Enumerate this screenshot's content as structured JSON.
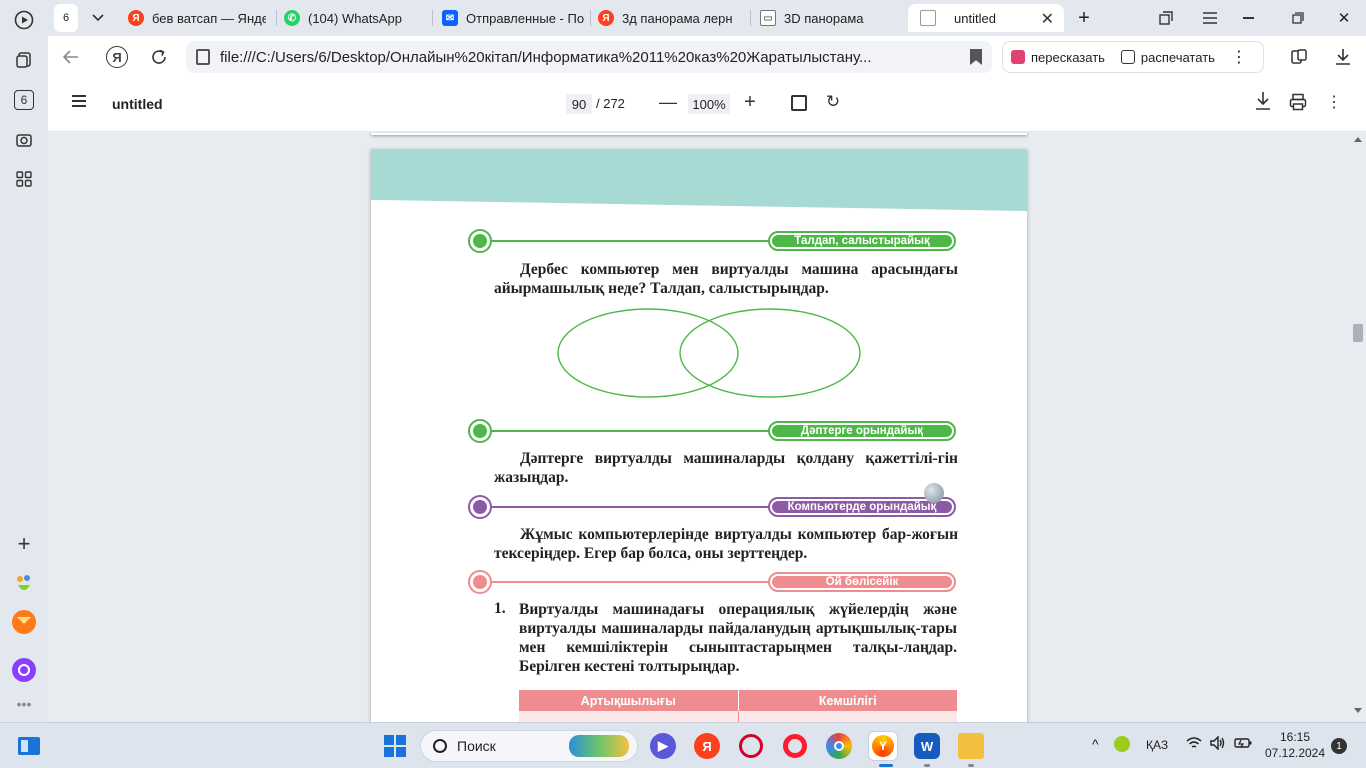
{
  "tabs": [
    {
      "count": "6"
    },
    {
      "title": "бев ватсап — Яндекс",
      "icon": "yandex-icon",
      "color": "#fc3f1d"
    },
    {
      "title": "(104) WhatsApp",
      "icon": "whatsapp-icon",
      "color": "#25d366"
    },
    {
      "title": "Отправленные - Почта",
      "icon": "mail-icon",
      "color": "#0a62ff"
    },
    {
      "title": "3д панорама лерн",
      "icon": "yandex-icon",
      "color": "#fc3f1d"
    },
    {
      "title": "3D панорама",
      "icon": "document-icon",
      "color": "#777777"
    },
    {
      "title": "untitled",
      "icon": "pdf-file-icon",
      "color": "#777777"
    }
  ],
  "address": {
    "url": "file:///C:/Users/6/Desktop/Онлайын%20кітап/Информатика%2011%20каз%20Жаратылыстану..."
  },
  "actions": {
    "retell": "пересказать",
    "print": "распечатать"
  },
  "sidebar": {
    "badge": "6"
  },
  "pdf": {
    "title": "untitled",
    "page": "90",
    "total": "/ 272",
    "zoom": "100%"
  },
  "document": {
    "section1": "Талдап, салыстырайық",
    "para1": "Дербес компьютер мен виртуалды машина арасындағы айырмашылық неде? Талдап, салыстырыңдар.",
    "section2": "Дәптерге орындайық",
    "para2": "Дәптерге виртуалды машиналарды қолдану қажеттілі-гін жазыңдар.",
    "section3": "Компьютерде орындайық",
    "para3": "Жұмыс компьютерлерінде виртуалды компьютер бар-жоғын тексеріңдер. Егер бар болса, оны зерттеңдер.",
    "section4": "Ой бөлісейік",
    "item_number": "1.",
    "para4": "Виртуалды машинадағы операциялық жүйелердің және виртуалды машиналарды пайдаланудың артықшылық-тары мен кемшіліктерін сыныптастарыңмен талқы-лаңдар. Берілген кестені толтырыңдар.",
    "table_headers": [
      "Артықшылығы",
      "Кемшілігі"
    ],
    "colors": {
      "green": "#4db848",
      "purple": "#8d5aa5",
      "pink": "#ef8c90",
      "header": "#a8dad5"
    }
  },
  "taskbar": {
    "search": "Поиск",
    "lang": "ҚАЗ",
    "time": "16:15",
    "date": "07.12.2024",
    "notifications": "1"
  }
}
